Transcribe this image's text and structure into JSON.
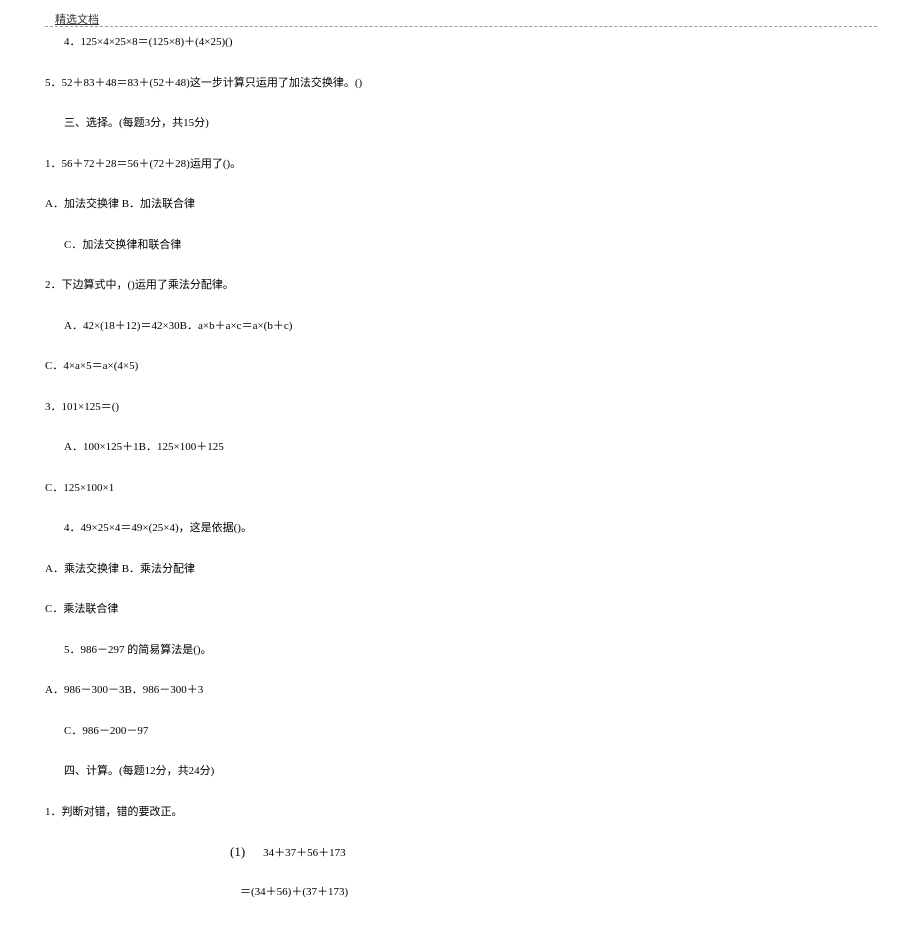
{
  "header": {
    "label": "精选文档"
  },
  "lines": {
    "l1": "4．125×4×25×8＝(125×8)＋(4×25)()",
    "l2": "5．52＋83＋48＝83＋(52＋48)这一步计算只运用了加法交换律。()",
    "l3": "三、选择。(每题3分，共15分)",
    "l4": "1．56＋72＋28＝56＋(72＋28)运用了()。",
    "l5": "A．加法交换律 B．加法联合律",
    "l6": "C．加法交换律和联合律",
    "l7": "2．下边算式中，()运用了乘法分配律。",
    "l8": "A．42×(18＋12)＝42×30B．a×b＋a×c＝a×(b＋c)",
    "l9": "C．4×a×5＝a×(4×5)",
    "l10": "3．101×125＝()",
    "l11": "A．100×125＋1B．125×100＋125",
    "l12": "C．125×100×1",
    "l13": "4．49×25×4＝49×(25×4)，这是依据()。",
    "l14": "A．乘法交换律 B．乘法分配律",
    "l15": "C．乘法联合律",
    "l16": "5．986－297 的简易算法是()。",
    "l17": "A．986－300－3B．986－300＋3",
    "l18": "C．986－200－97",
    "l19": "四、计算。(每题12分，共24分)",
    "l20": "1．判断对错，错的要改正。",
    "calc_label": "(1)",
    "calc_expr": "34＋37＋56＋173",
    "calc_eq": "＝(34＋56)＋(37＋173)"
  }
}
